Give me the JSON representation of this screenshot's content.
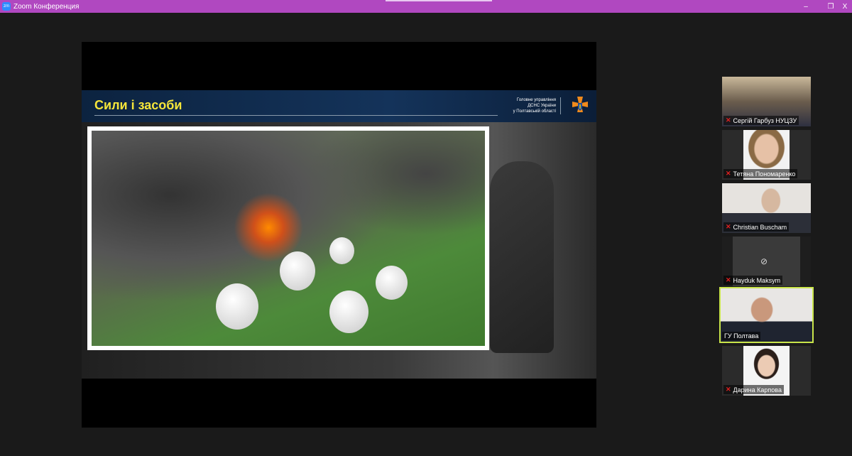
{
  "window": {
    "title": "Zoom Конференция",
    "app_icon": "zm",
    "controls": {
      "minimize": "–",
      "restore": "❐",
      "close": "X"
    }
  },
  "slide": {
    "title": "Сили і засоби",
    "org_lines": [
      "Головне управління",
      "ДСНС України",
      "у Полтавській області"
    ]
  },
  "participants": [
    {
      "name": "Сергій Гарбуз НУЦЗУ",
      "muted": true
    },
    {
      "name": "Тетяна Пономаренко",
      "muted": true
    },
    {
      "name": "Christian Buscham",
      "muted": true
    },
    {
      "name": "Hayduk Maksym",
      "muted": true,
      "video_off": true
    },
    {
      "name": "ГУ Полтава",
      "muted": false,
      "active_speaker": true
    },
    {
      "name": "Дарина Карпова",
      "muted": true
    }
  ],
  "colors": {
    "titlebar": "#b048c0",
    "active_border": "#c9e54a",
    "slide_title": "#f5e53a"
  }
}
